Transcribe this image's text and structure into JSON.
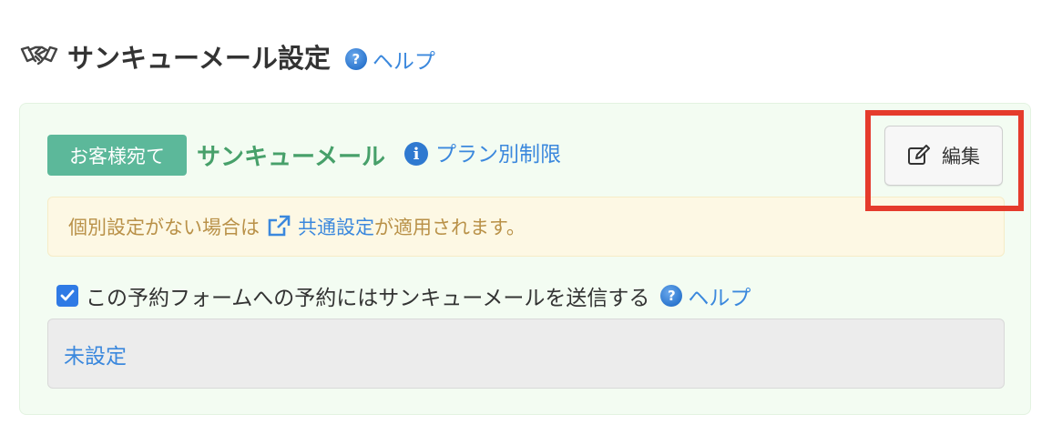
{
  "header": {
    "title": "サンキューメール設定",
    "help_label": "ヘルプ"
  },
  "panel": {
    "badge": "お客様宛て",
    "mail_title": "サンキューメール",
    "plan_link": "プラン別制限",
    "edit_button": "編集",
    "notice": {
      "prefix": "個別設定がない場合は",
      "link": "共通設定",
      "suffix": "が適用されます。"
    },
    "checkbox": {
      "checked": true,
      "label": "この予約フォームへの予約にはサンキューメールを送信する",
      "help_label": "ヘルプ"
    },
    "status_value": "未設定"
  },
  "icons": [
    "handshake-icon",
    "help-icon",
    "info-icon",
    "external-link-icon",
    "edit-icon",
    "check-icon"
  ],
  "colors": {
    "badge": "#5cb89a",
    "mail_title": "#47a06a",
    "link": "#3b88dd",
    "notice_text": "#b99148",
    "highlight": "#e53b2c"
  }
}
